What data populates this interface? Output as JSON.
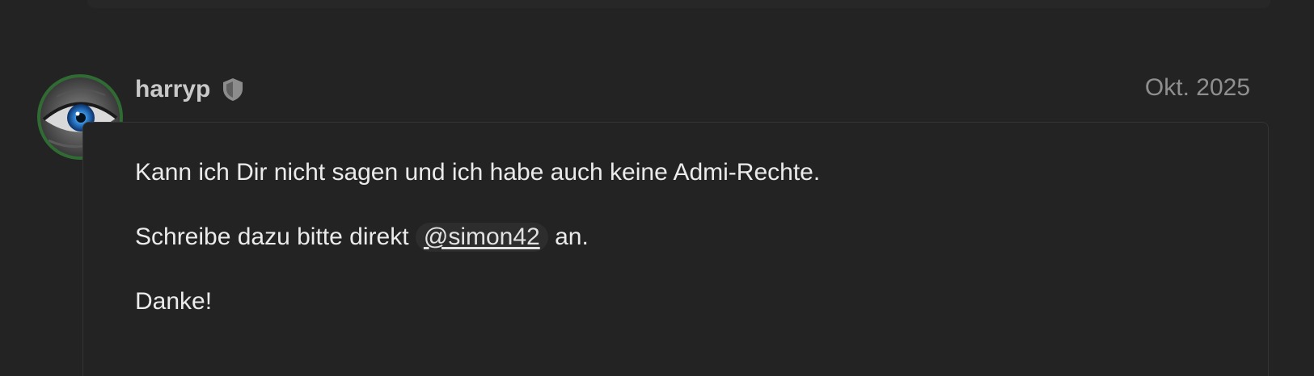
{
  "post": {
    "author": "harryp",
    "author_badge_icon": "shield-icon",
    "date": "Okt. 2025",
    "paragraphs": {
      "p1": "Kann ich Dir nicht sagen und ich habe auch keine Admi-Rechte.",
      "p2_before": "Schreibe dazu bitte direkt ",
      "p2_mention": "@simon42",
      "p2_after": " an.",
      "p3": "Danke!"
    }
  },
  "colors": {
    "background": "#232323",
    "avatar_ring": "#2f6b33",
    "username": "#c9c9c9",
    "date": "#8f8f8f",
    "text": "#ebebeb",
    "mention_bg": "#2d2d2d"
  }
}
